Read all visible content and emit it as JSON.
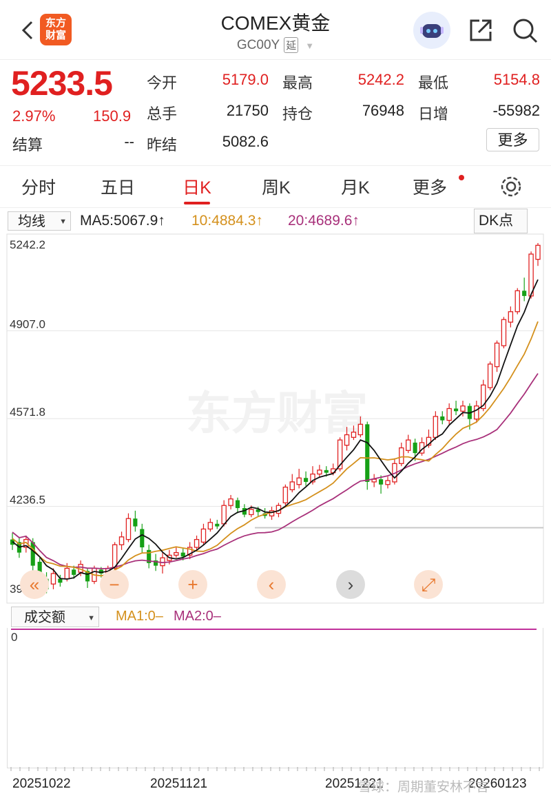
{
  "header": {
    "logo_text": "东方\n财富",
    "title": "COMEX黄金",
    "code": "GC00Y",
    "delay_tag": "延"
  },
  "quote": {
    "price": "5233.5",
    "change_pct": "2.97%",
    "change": "150.9",
    "fields": [
      {
        "label": "今开",
        "value": "5179.0",
        "color": "red"
      },
      {
        "label": "最高",
        "value": "5242.2",
        "color": "red"
      },
      {
        "label": "最低",
        "value": "5154.8",
        "color": "red"
      },
      {
        "label": "总手",
        "value": "21750",
        "color": "dark"
      },
      {
        "label": "持仓",
        "value": "76948",
        "color": "dark"
      },
      {
        "label": "日增",
        "value": "-55982",
        "color": "dark"
      },
      {
        "label": "结算",
        "value": "--",
        "color": "dark"
      },
      {
        "label": "昨结",
        "value": "5082.6",
        "color": "dark"
      }
    ],
    "more_label": "更多"
  },
  "tabs": [
    {
      "label": "分时",
      "active": false
    },
    {
      "label": "五日",
      "active": false
    },
    {
      "label": "日K",
      "active": true
    },
    {
      "label": "周K",
      "active": false
    },
    {
      "label": "月K",
      "active": false
    },
    {
      "label": "更多",
      "active": false
    }
  ],
  "ma_bar": {
    "select_label": "均线",
    "ma5": "MA5:5067.9↑",
    "ma10": "10:4884.3↑",
    "ma20": "20:4689.6↑",
    "dk_label": "DK点"
  },
  "chart_data": {
    "type": "candlestick",
    "y_ticks": [
      "5242.2",
      "4907.0",
      "4571.8",
      "4236.5",
      "3901.3"
    ],
    "ylim": [
      3901.3,
      5242.2
    ],
    "reference_line": 4155,
    "candles": [
      {
        "o": 4110,
        "c": 4090,
        "h": 4135,
        "l": 4070
      },
      {
        "o": 4100,
        "c": 4060,
        "h": 4120,
        "l": 4040
      },
      {
        "o": 4080,
        "c": 4110,
        "h": 4125,
        "l": 4060
      },
      {
        "o": 4100,
        "c": 4010,
        "h": 4115,
        "l": 3990
      },
      {
        "o": 4025,
        "c": 3950,
        "h": 4040,
        "l": 3930
      },
      {
        "o": 3960,
        "c": 3920,
        "h": 3985,
        "l": 3905
      },
      {
        "o": 3940,
        "c": 3980,
        "h": 4000,
        "l": 3920
      },
      {
        "o": 3960,
        "c": 3945,
        "h": 3975,
        "l": 3930
      },
      {
        "o": 3960,
        "c": 4000,
        "h": 4020,
        "l": 3950
      },
      {
        "o": 3995,
        "c": 3975,
        "h": 4010,
        "l": 3960
      },
      {
        "o": 3985,
        "c": 4015,
        "h": 4030,
        "l": 3970
      },
      {
        "o": 3990,
        "c": 3950,
        "h": 4000,
        "l": 3925
      },
      {
        "o": 3950,
        "c": 4000,
        "h": 4010,
        "l": 3940
      },
      {
        "o": 3995,
        "c": 3980,
        "h": 4005,
        "l": 3965
      },
      {
        "o": 3980,
        "c": 4000,
        "h": 4010,
        "l": 3970
      },
      {
        "o": 4000,
        "c": 4090,
        "h": 4100,
        "l": 3990
      },
      {
        "o": 4090,
        "c": 4120,
        "h": 4140,
        "l": 4070
      },
      {
        "o": 4110,
        "c": 4190,
        "h": 4210,
        "l": 4100
      },
      {
        "o": 4190,
        "c": 4160,
        "h": 4220,
        "l": 4140
      },
      {
        "o": 4150,
        "c": 4080,
        "h": 4170,
        "l": 4060
      },
      {
        "o": 4070,
        "c": 4020,
        "h": 4090,
        "l": 4000
      },
      {
        "o": 4030,
        "c": 4010,
        "h": 4055,
        "l": 3990
      },
      {
        "o": 4010,
        "c": 4040,
        "h": 4060,
        "l": 3980
      },
      {
        "o": 4030,
        "c": 4050,
        "h": 4070,
        "l": 4015
      },
      {
        "o": 4050,
        "c": 4060,
        "h": 4080,
        "l": 4040
      },
      {
        "o": 4060,
        "c": 4045,
        "h": 4075,
        "l": 4030
      },
      {
        "o": 4050,
        "c": 4080,
        "h": 4100,
        "l": 4035
      },
      {
        "o": 4080,
        "c": 4110,
        "h": 4125,
        "l": 4070
      },
      {
        "o": 4100,
        "c": 4150,
        "h": 4170,
        "l": 4090
      },
      {
        "o": 4150,
        "c": 4175,
        "h": 4190,
        "l": 4140
      },
      {
        "o": 4170,
        "c": 4160,
        "h": 4185,
        "l": 4150
      },
      {
        "o": 4170,
        "c": 4240,
        "h": 4260,
        "l": 4160
      },
      {
        "o": 4240,
        "c": 4265,
        "h": 4280,
        "l": 4225
      },
      {
        "o": 4260,
        "c": 4230,
        "h": 4270,
        "l": 4210
      },
      {
        "o": 4230,
        "c": 4205,
        "h": 4245,
        "l": 4195
      },
      {
        "o": 4205,
        "c": 4225,
        "h": 4240,
        "l": 4195
      },
      {
        "o": 4225,
        "c": 4215,
        "h": 4235,
        "l": 4200
      },
      {
        "o": 4210,
        "c": 4200,
        "h": 4230,
        "l": 4190
      },
      {
        "o": 4200,
        "c": 4220,
        "h": 4235,
        "l": 4185
      },
      {
        "o": 4210,
        "c": 4240,
        "h": 4250,
        "l": 4195
      },
      {
        "o": 4250,
        "c": 4310,
        "h": 4320,
        "l": 4240
      },
      {
        "o": 4300,
        "c": 4330,
        "h": 4360,
        "l": 4290
      },
      {
        "o": 4320,
        "c": 4345,
        "h": 4380,
        "l": 4305
      },
      {
        "o": 4345,
        "c": 4330,
        "h": 4370,
        "l": 4315
      },
      {
        "o": 4330,
        "c": 4360,
        "h": 4390,
        "l": 4320
      },
      {
        "o": 4360,
        "c": 4375,
        "h": 4395,
        "l": 4345
      },
      {
        "o": 4375,
        "c": 4365,
        "h": 4390,
        "l": 4350
      },
      {
        "o": 4365,
        "c": 4380,
        "h": 4400,
        "l": 4355
      },
      {
        "o": 4380,
        "c": 4490,
        "h": 4500,
        "l": 4370
      },
      {
        "o": 4470,
        "c": 4510,
        "h": 4540,
        "l": 4450
      },
      {
        "o": 4500,
        "c": 4520,
        "h": 4545,
        "l": 4490
      },
      {
        "o": 4510,
        "c": 4550,
        "h": 4580,
        "l": 4500
      },
      {
        "o": 4550,
        "c": 4330,
        "h": 4560,
        "l": 4300
      },
      {
        "o": 4330,
        "c": 4340,
        "h": 4360,
        "l": 4310
      },
      {
        "o": 4340,
        "c": 4320,
        "h": 4355,
        "l": 4285
      },
      {
        "o": 4320,
        "c": 4335,
        "h": 4350,
        "l": 4305
      },
      {
        "o": 4330,
        "c": 4400,
        "h": 4420,
        "l": 4320
      },
      {
        "o": 4400,
        "c": 4460,
        "h": 4480,
        "l": 4390
      },
      {
        "o": 4450,
        "c": 4490,
        "h": 4510,
        "l": 4440
      },
      {
        "o": 4480,
        "c": 4440,
        "h": 4495,
        "l": 4410
      },
      {
        "o": 4440,
        "c": 4480,
        "h": 4500,
        "l": 4430
      },
      {
        "o": 4470,
        "c": 4500,
        "h": 4530,
        "l": 4460
      },
      {
        "o": 4500,
        "c": 4580,
        "h": 4600,
        "l": 4490
      },
      {
        "o": 4580,
        "c": 4565,
        "h": 4600,
        "l": 4550
      },
      {
        "o": 4565,
        "c": 4610,
        "h": 4630,
        "l": 4550
      },
      {
        "o": 4610,
        "c": 4600,
        "h": 4640,
        "l": 4585
      },
      {
        "o": 4600,
        "c": 4620,
        "h": 4640,
        "l": 4580
      },
      {
        "o": 4620,
        "c": 4570,
        "h": 4630,
        "l": 4530
      },
      {
        "o": 4570,
        "c": 4620,
        "h": 4640,
        "l": 4555
      },
      {
        "o": 4610,
        "c": 4700,
        "h": 4720,
        "l": 4600
      },
      {
        "o": 4690,
        "c": 4780,
        "h": 4790,
        "l": 4680
      },
      {
        "o": 4770,
        "c": 4860,
        "h": 4870,
        "l": 4750
      },
      {
        "o": 4850,
        "c": 4950,
        "h": 4960,
        "l": 4840
      },
      {
        "o": 4940,
        "c": 4980,
        "h": 5000,
        "l": 4920
      },
      {
        "o": 4980,
        "c": 5060,
        "h": 5070,
        "l": 4970
      },
      {
        "o": 5060,
        "c": 5040,
        "h": 5110,
        "l": 5020
      },
      {
        "o": 5040,
        "c": 5200,
        "h": 5210,
        "l": 5030
      },
      {
        "o": 5180,
        "c": 5233.5,
        "h": 5242.2,
        "l": 5154.8
      }
    ],
    "x_labels": [
      "20251022",
      "20251121",
      "20251221",
      "20260123"
    ]
  },
  "controls": [
    "«",
    "−",
    "+",
    "‹",
    "›",
    "⤢"
  ],
  "volume": {
    "select_label": "成交额",
    "ma1": "MA1:0–",
    "ma2": "MA2:0–",
    "zero": "0"
  },
  "watermark": "雪球：周期董安林不言",
  "chart_watermark": "东方财富",
  "colors": {
    "up": "#e02020",
    "down": "#16a016",
    "ma5": "#111111",
    "ma10": "#d4901c",
    "ma20": "#a8307a"
  }
}
